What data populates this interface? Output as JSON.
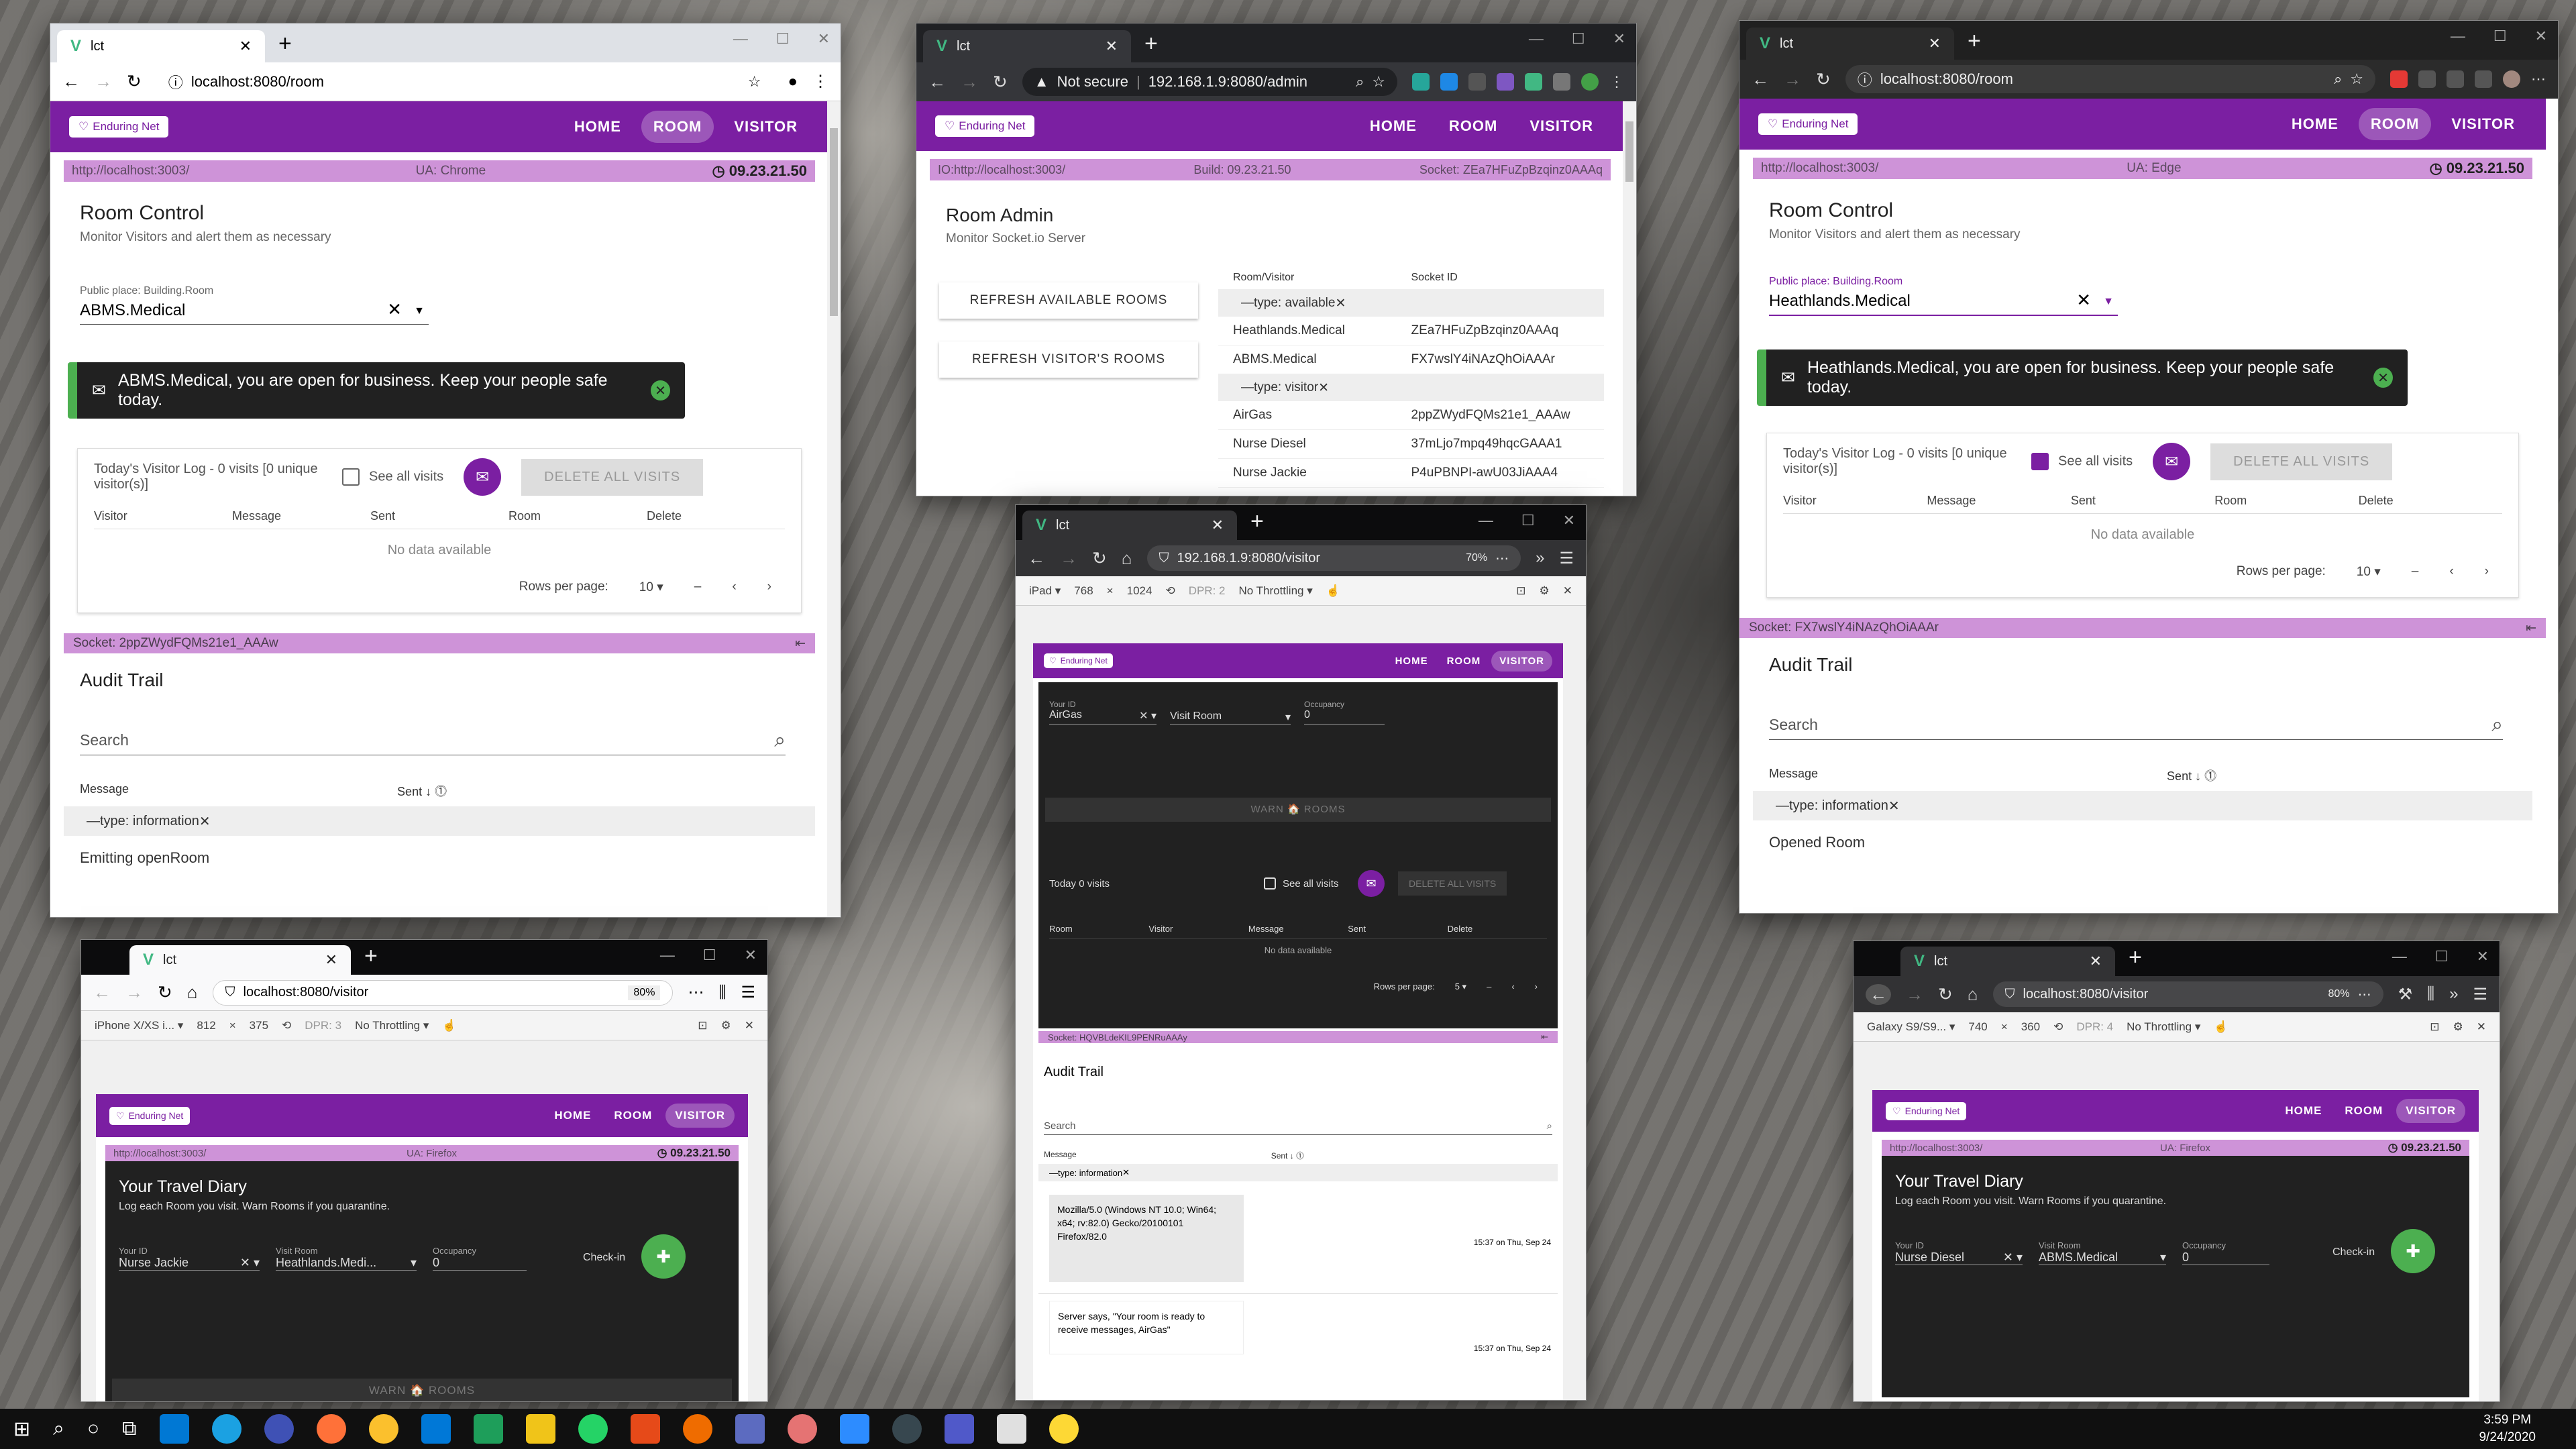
{
  "tab_title": "lct",
  "brand": "Enduring Net",
  "nav": [
    "HOME",
    "ROOM",
    "VISITOR"
  ],
  "w1": {
    "url": "localhost:8080/room",
    "server": "http://localhost:3003/",
    "ua": "UA: Chrome",
    "version": "09.23.21.50",
    "title": "Room Control",
    "subtitle": "Monitor Visitors and alert them as necessary",
    "field_label": "Public place: Building.Room",
    "field_value": "ABMS.Medical",
    "alert": "ABMS.Medical, you are open for business. Keep your people safe today.",
    "log_summary": "Today's Visitor Log - 0 visits [0 unique visitor(s)]",
    "see_all": "See all visits",
    "delete_all": "DELETE ALL VISITS",
    "cols": [
      "Visitor",
      "Message",
      "Sent",
      "Room",
      "Delete"
    ],
    "no_data": "No data available",
    "rows_per_page": "Rows per page:",
    "rows_value": "10",
    "range": "–",
    "socket": "Socket: 2ppZWydFQMs21e1_AAAw",
    "audit": "Audit Trail",
    "search": "Search",
    "msg_col": "Message",
    "sent_col": "Sent",
    "sort_badge": "1",
    "group": "type: information",
    "partial_row": "Emitting openRoom"
  },
  "w2": {
    "not_secure": "Not secure",
    "url": "192.168.1.9:8080/admin",
    "io": "IO:http://localhost:3003/",
    "build": "Build: 09.23.21.50",
    "socket": "Socket: ZEa7HFuZpBzqinz0AAAq",
    "title": "Room Admin",
    "subtitle": "Monitor Socket.io Server",
    "btn1": "REFRESH AVAILABLE ROOMS",
    "btn2": "REFRESH VISITOR'S ROOMS",
    "cols": [
      "Room/Visitor",
      "Socket ID"
    ],
    "group1": "type: available",
    "group2": "type: visitor",
    "rows1": [
      [
        "Heathlands.Medical",
        "ZEa7HFuZpBzqinz0AAAq"
      ],
      [
        "ABMS.Medical",
        "FX7wslY4iNAzQhOiAAAr"
      ]
    ],
    "rows2": [
      [
        "AirGas",
        "2ppZWydFQMs21e1_AAAw"
      ],
      [
        "Nurse Diesel",
        "37mLjo7mpq49hqcGAAA1"
      ],
      [
        "Nurse Jackie",
        "P4uPBNPI-awU03JiAAA4"
      ]
    ]
  },
  "w3": {
    "url": "localhost:8080/room",
    "server": "http://localhost:3003/",
    "ua": "UA: Edge",
    "version": "09.23.21.50",
    "title": "Room Control",
    "subtitle": "Monitor Visitors and alert them as necessary",
    "field_label": "Public place: Building.Room",
    "field_value": "Heathlands.Medical",
    "alert": "Heathlands.Medical, you are open for business. Keep your people safe today.",
    "log_summary": "Today's Visitor Log - 0 visits [0 unique visitor(s)]",
    "see_all": "See all visits",
    "delete_all": "DELETE ALL VISITS",
    "no_data": "No data available",
    "rows_per_page": "Rows per page:",
    "rows_value": "10",
    "range": "–",
    "socket": "Socket: FX7wslY4iNAzQhOiAAAr",
    "audit": "Audit Trail",
    "search": "Search",
    "msg_col": "Message",
    "sent_col": "Sent",
    "sort_badge": "1",
    "group": "type: information",
    "partial_row": "Opened Room"
  },
  "w4": {
    "url": "192.168.1.9:8080/visitor",
    "zoom": "70%",
    "device": "iPad",
    "w": "768",
    "h": "1024",
    "dpr": "DPR: 2",
    "throttle": "No Throttling",
    "your_id_label": "Your ID",
    "your_id": "AirGas",
    "visit_label": "Visit Room",
    "visit_value": "",
    "occ_label": "Occupancy",
    "occ_value": "0",
    "warn": "WARN 🏠 ROOMS",
    "today": "Today 0 visits",
    "see_all": "See all visits",
    "delete_all": "DELETE ALL VISITS",
    "cols": [
      "Room",
      "Visitor",
      "Message",
      "Sent",
      "Delete"
    ],
    "no_data": "No data available",
    "rows_per_page": "Rows per page:",
    "rows_value": "5",
    "range": "–",
    "socket": "Socket: HQVBLdeKIL9PENRuAAAy",
    "audit": "Audit Trail",
    "search": "Search",
    "msg_col": "Message",
    "sent_col": "Sent",
    "sort_badge": "1",
    "group": "type: information",
    "msg1": "Mozilla/5.0 (Windows NT 10.0; Win64; x64; rv:82.0) Gecko/20100101 Firefox/82.0",
    "time1": "15:37 on Thu, Sep 24",
    "msg2": "Server says, \"Your room is ready to receive messages, AirGas\"",
    "time2": "15:37 on Thu, Sep 24"
  },
  "w5": {
    "url": "localhost:8080/visitor",
    "zoom": "80%",
    "device": "iPhone X/XS i...",
    "w": "812",
    "h": "375",
    "dpr": "DPR: 3",
    "throttle": "No Throttling",
    "server": "http://localhost:3003/",
    "ua": "UA: Firefox",
    "version": "09.23.21.50",
    "title": "Your Travel Diary",
    "subtitle": "Log each Room you visit. Warn Rooms if you quarantine.",
    "your_id_label": "Your ID",
    "your_id": "Nurse Jackie",
    "visit_label": "Visit Room",
    "visit_value": "Heathlands.Medi...",
    "occ_label": "Occupancy",
    "occ_value": "0",
    "checkin": "Check-in",
    "warn": "WARN 🏠 ROOMS"
  },
  "w6": {
    "url": "localhost:8080/visitor",
    "zoom": "80%",
    "device": "Galaxy S9/S9...",
    "w": "740",
    "h": "360",
    "dpr": "DPR: 4",
    "throttle": "No Throttling",
    "server": "http://localhost:3003/",
    "ua": "UA: Firefox",
    "version": "09.23.21.50",
    "title": "Your Travel Diary",
    "subtitle": "Log each Room you visit. Warn Rooms if you quarantine.",
    "your_id_label": "Your ID",
    "your_id": "Nurse Diesel",
    "visit_label": "Visit Room",
    "visit_value": "ABMS.Medical",
    "occ_label": "Occupancy",
    "occ_value": "0",
    "checkin": "Check-in"
  },
  "clock": {
    "time": "3:59 PM",
    "date": "9/24/2020"
  },
  "colors": {
    "brand": "#7b1fa2",
    "info": "#ce93d8",
    "success": "#4caf50"
  }
}
